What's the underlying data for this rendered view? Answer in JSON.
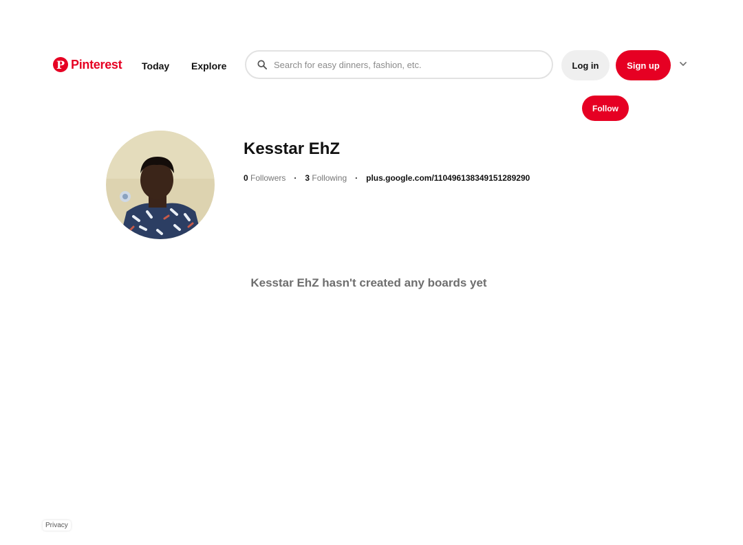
{
  "header": {
    "logo_text": "Pinterest",
    "logo_mark": "P",
    "nav": {
      "today": "Today",
      "explore": "Explore"
    },
    "search": {
      "placeholder": "Search for easy dinners, fashion, etc.",
      "value": "",
      "icon": "search-icon"
    },
    "login_label": "Log in",
    "signup_label": "Sign up",
    "more_icon": "chevron-down-icon"
  },
  "profile": {
    "follow_label": "Follow",
    "name": "Kesstar EhZ",
    "followers_count": "0",
    "followers_label": "Followers",
    "following_count": "3",
    "following_label": "Following",
    "separator": "·",
    "website": "plus.google.com/110496138349151289290"
  },
  "empty_state": "Kesstar EhZ hasn't created any boards yet",
  "footer": {
    "privacy_label": "Privacy"
  },
  "colors": {
    "brand": "#e60023",
    "button_gray": "#efefef"
  }
}
